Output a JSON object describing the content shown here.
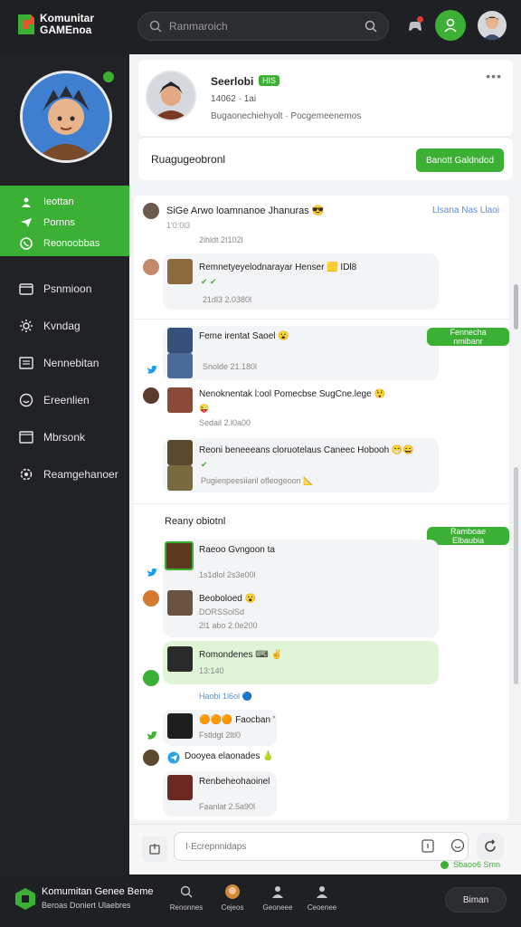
{
  "header": {
    "logo_line1": "Komunitar",
    "logo_line2": "GAMEnoa",
    "search_placeholder": "Ranmaroich"
  },
  "sidebar": {
    "green_items": [
      {
        "label": "Ieottan",
        "icon": "user-icon"
      },
      {
        "label": "Pornns",
        "icon": "send-icon"
      },
      {
        "label": "Reonoobbas",
        "icon": "whatsapp-icon"
      }
    ],
    "nav_items": [
      {
        "label": "Psnmioon",
        "icon": "folder-icon"
      },
      {
        "label": "Kvndag",
        "icon": "gear-icon"
      },
      {
        "label": "Nennebitan",
        "icon": "document-icon"
      },
      {
        "label": "Ereenlien",
        "icon": "smile-icon"
      },
      {
        "label": "Mbrsonk",
        "icon": "window-icon"
      },
      {
        "label": "Reamgehanoer",
        "icon": "settings-icon"
      }
    ]
  },
  "profile": {
    "name": "Seerlobi",
    "tag": "HIS",
    "line1": "14062 · 1ai",
    "line2": "Bugaonechiehyolt · Pocgemeenemos"
  },
  "reply": {
    "label": "Ruagugeobronl",
    "button": "Banott Galdndod"
  },
  "feed": {
    "head": {
      "title": "SiGe Arwo loamnanoe Jhanuras 😎",
      "right": "Llsana Nas Llaoi",
      "sub": "1'0:0l3"
    },
    "messages": [
      {
        "ts": "2ihldt 2I102I"
      },
      {
        "text": "Remnetyeyelodnarayar Henser 🟨 IDl8",
        "sub": "✔ ✔",
        "ts": "21dl3 2.0380l"
      },
      {
        "text": "Feme irentat Saoel 😮",
        "pill": "Fennecha nmibanr",
        "ts": "Snolde 21.180l"
      },
      {
        "text": "Nenoknentak l:ool Pomecbse SugCne.lege 😲",
        "sub": "😜",
        "ts": "Sedail 2.l0a00"
      },
      {
        "text": "Reoni beneeeans cloruotelaus Caneec Hobooh 😁😄",
        "sub": "✔",
        "ts2": "Pugienpeesiianl ofleogeoon 📐"
      }
    ],
    "section2_title": "Reany obiotnl",
    "section2_pill": "Ramboae Elbaubia",
    "messages2": [
      {
        "text": "Raeoo Gvngoon ta",
        "ts": "1s1dlol 2s3e00l"
      },
      {
        "text": "Beoboloed 😮",
        "sub": "DORSSolSd",
        "ts": "2l1 abo 2.0e200"
      },
      {
        "text": "Romondenes ⌨ ✌",
        "ts": "13:140"
      },
      {
        "ts": "Haobi 1l6ol 🔵"
      },
      {
        "text": "🟠🟠🟠 Faocban '",
        "ts": "Fstldgt 2ltl0"
      },
      {
        "text": "Dooyea elaonades 🍐"
      },
      {
        "text": "Renbeheohaoinel",
        "ts": "Faanlat 2.5a90l"
      }
    ]
  },
  "composer": {
    "placeholder": "I·Ecrepnnidaps",
    "status": "Sbaoo6 Smn"
  },
  "footer": {
    "title": "Komumitan Genee Beme",
    "subtitle": "Beroas Doniert Ulaebres",
    "nav": [
      "Renonnes",
      "Cejeos",
      "Geoneee",
      "Ceoenee"
    ],
    "button": "Biman"
  },
  "colors": {
    "accent": "#3cb034",
    "sidebar": "#212226",
    "topbar": "#1f2023"
  }
}
